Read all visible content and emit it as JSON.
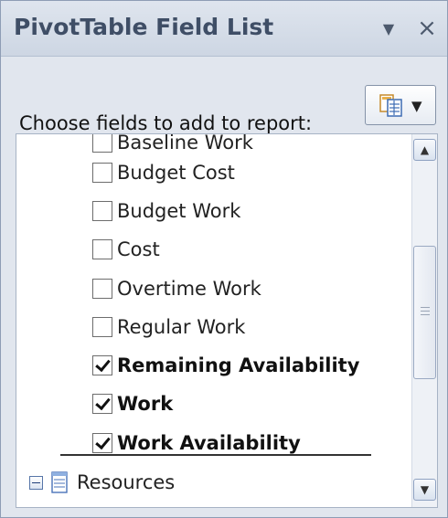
{
  "panel": {
    "title": "PivotTable Field List",
    "dropdown_glyph": "▼",
    "close_glyph": "×"
  },
  "toolbar": {
    "choose_label": "Choose fields to add to report:",
    "layout_button_icon": "field-list-layout-icon",
    "layout_caret": "▼"
  },
  "fields": [
    {
      "label": "Baseline Work",
      "checked": false
    },
    {
      "label": "Budget Cost",
      "checked": false
    },
    {
      "label": "Budget Work",
      "checked": false
    },
    {
      "label": "Cost",
      "checked": false
    },
    {
      "label": "Overtime Work",
      "checked": false
    },
    {
      "label": "Regular Work",
      "checked": false
    },
    {
      "label": "Remaining Availability",
      "checked": true
    },
    {
      "label": "Work",
      "checked": true
    },
    {
      "label": "Work Availability",
      "checked": true
    }
  ],
  "tree": {
    "resources_label": "Resources",
    "expander_state": "expanded"
  },
  "scrollbar": {
    "up_glyph": "▲",
    "down_glyph": "▼"
  },
  "colors": {
    "title_text": "#3f4e66",
    "list_background": "#ffffff",
    "panel_background": "#e1e6ee"
  }
}
